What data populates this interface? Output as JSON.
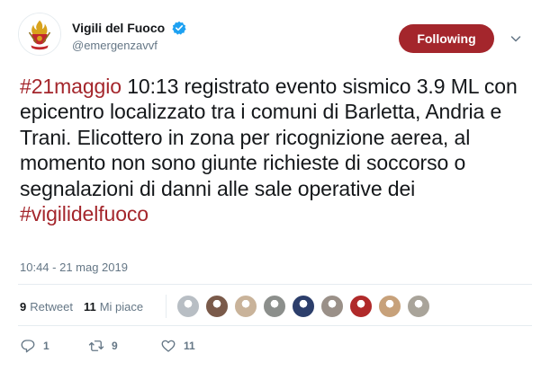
{
  "account": {
    "display_name": "Vigili del Fuoco",
    "screen_name": "@emergenzavvf",
    "verified": true,
    "follow_label": "Following"
  },
  "tweet": {
    "segments": [
      {
        "text": "#21maggio",
        "hashtag": true
      },
      {
        "text": " 10:13 registrato evento sismico 3.9 ML con epicentro localizzato tra i comuni di Barletta, Andria e Trani. Elicottero in zona per ricognizione aerea, al momento non sono giunte richieste di soccorso o segnalazioni di danni alle sale operative dei ",
        "hashtag": false
      },
      {
        "text": "#vigilidelfuoco",
        "hashtag": true
      }
    ],
    "timestamp": "10:44 - 21 mag 2019"
  },
  "stats": {
    "retweet_count": "9",
    "retweet_label": "Retweet",
    "like_count": "11",
    "like_label": "Mi piace"
  },
  "likers": [
    {
      "color": "#b8bec4"
    },
    {
      "color": "#7a5a4a"
    },
    {
      "color": "#c9b39a"
    },
    {
      "color": "#8c8f8c"
    },
    {
      "color": "#2c3e6b"
    },
    {
      "color": "#9a9088"
    },
    {
      "color": "#b02a2a"
    },
    {
      "color": "#c7a17a"
    },
    {
      "color": "#a9a49a"
    }
  ],
  "actions": {
    "reply_count": "1",
    "retweet_count": "9",
    "like_count": "11"
  },
  "colors": {
    "accent": "#a4262c",
    "secondary_text": "#657786",
    "divider": "#e6ecf0"
  },
  "icons": {
    "avatar": "fire-brigade-logo",
    "verified": "verified-badge-icon",
    "caret": "chevron-down-icon",
    "reply": "reply-icon",
    "retweet": "retweet-icon",
    "like": "heart-icon"
  }
}
